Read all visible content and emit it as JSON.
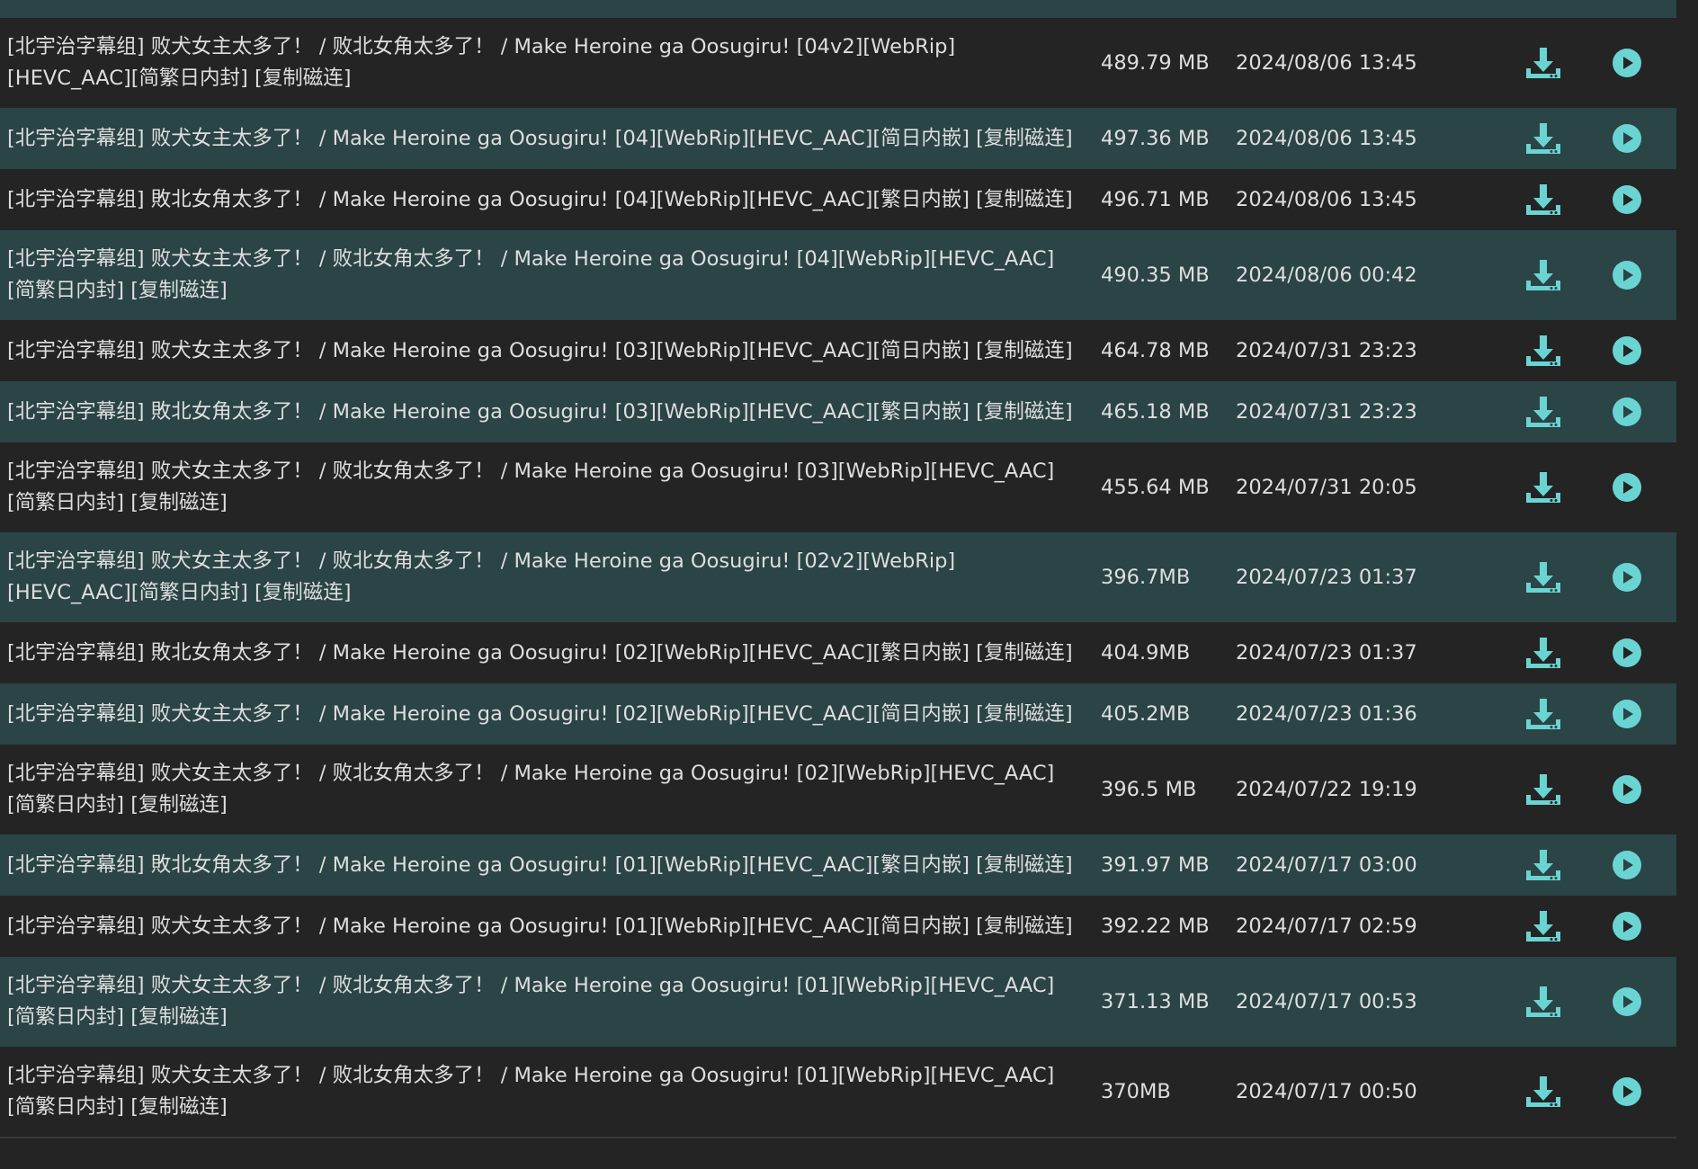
{
  "accent_color": "#6ad4d3",
  "rows": [
    {
      "title": "[北宇治字幕组] 败犬女主太多了！ / 败北女角太多了！ / Make Heroine ga Oosugiru! [04v2][WebRip]\n[HEVC_AAC][简繁日内封] [复制磁连]",
      "size": "489.79 MB",
      "date": "2024/08/06 13:45"
    },
    {
      "title": "[北宇治字幕组] 败犬女主太多了！ / Make Heroine ga Oosugiru! [04][WebRip][HEVC_AAC][简日内嵌] [复制磁连]",
      "size": "497.36 MB",
      "date": "2024/08/06 13:45"
    },
    {
      "title": "[北宇治字幕组] 敗北女角太多了！ / Make Heroine ga Oosugiru! [04][WebRip][HEVC_AAC][繁日内嵌] [复制磁连]",
      "size": "496.71 MB",
      "date": "2024/08/06 13:45"
    },
    {
      "title": "[北宇治字幕组] 败犬女主太多了！ / 败北女角太多了！ / Make Heroine ga Oosugiru! [04][WebRip][HEVC_AAC]\n[简繁日内封] [复制磁连]",
      "size": "490.35 MB",
      "date": "2024/08/06 00:42"
    },
    {
      "title": "[北宇治字幕组] 败犬女主太多了！ / Make Heroine ga Oosugiru! [03][WebRip][HEVC_AAC][简日内嵌] [复制磁连]",
      "size": "464.78 MB",
      "date": "2024/07/31 23:23"
    },
    {
      "title": "[北宇治字幕组] 敗北女角太多了！ / Make Heroine ga Oosugiru! [03][WebRip][HEVC_AAC][繁日内嵌] [复制磁连]",
      "size": "465.18 MB",
      "date": "2024/07/31 23:23"
    },
    {
      "title": "[北宇治字幕组] 败犬女主太多了！ / 败北女角太多了！ / Make Heroine ga Oosugiru! [03][WebRip][HEVC_AAC]\n[简繁日内封] [复制磁连]",
      "size": "455.64 MB",
      "date": "2024/07/31 20:05"
    },
    {
      "title": "[北宇治字幕组] 败犬女主太多了！ / 败北女角太多了！ / Make Heroine ga Oosugiru! [02v2][WebRip]\n[HEVC_AAC][简繁日内封] [复制磁连]",
      "size": "396.7MB",
      "date": "2024/07/23 01:37"
    },
    {
      "title": "[北宇治字幕组] 敗北女角太多了！ / Make Heroine ga Oosugiru! [02][WebRip][HEVC_AAC][繁日内嵌] [复制磁连]",
      "size": "404.9MB",
      "date": "2024/07/23 01:37"
    },
    {
      "title": "[北宇治字幕组] 败犬女主太多了！ / Make Heroine ga Oosugiru! [02][WebRip][HEVC_AAC][简日内嵌] [复制磁连]",
      "size": "405.2MB",
      "date": "2024/07/23 01:36"
    },
    {
      "title": "[北宇治字幕组] 败犬女主太多了！ / 败北女角太多了！ / Make Heroine ga Oosugiru! [02][WebRip][HEVC_AAC]\n[简繁日内封] [复制磁连]",
      "size": "396.5 MB",
      "date": "2024/07/22 19:19"
    },
    {
      "title": "[北宇治字幕组] 敗北女角太多了！ / Make Heroine ga Oosugiru! [01][WebRip][HEVC_AAC][繁日内嵌] [复制磁连]",
      "size": "391.97 MB",
      "date": "2024/07/17 03:00"
    },
    {
      "title": "[北宇治字幕组] 败犬女主太多了！ / Make Heroine ga Oosugiru! [01][WebRip][HEVC_AAC][简日内嵌] [复制磁连]",
      "size": "392.22 MB",
      "date": "2024/07/17 02:59"
    },
    {
      "title": "[北宇治字幕组] 败犬女主太多了！ / 败北女角太多了！ / Make Heroine ga Oosugiru! [01][WebRip][HEVC_AAC]\n[简繁日内封] [复制磁连]",
      "size": "371.13 MB",
      "date": "2024/07/17 00:53"
    },
    {
      "title": "[北宇治字幕组] 败犬女主太多了！ / 败北女角太多了！ / Make Heroine ga Oosugiru! [01][WebRip][HEVC_AAC]\n[简繁日内封] [复制磁连]",
      "size": "370MB",
      "date": "2024/07/17 00:50"
    }
  ]
}
